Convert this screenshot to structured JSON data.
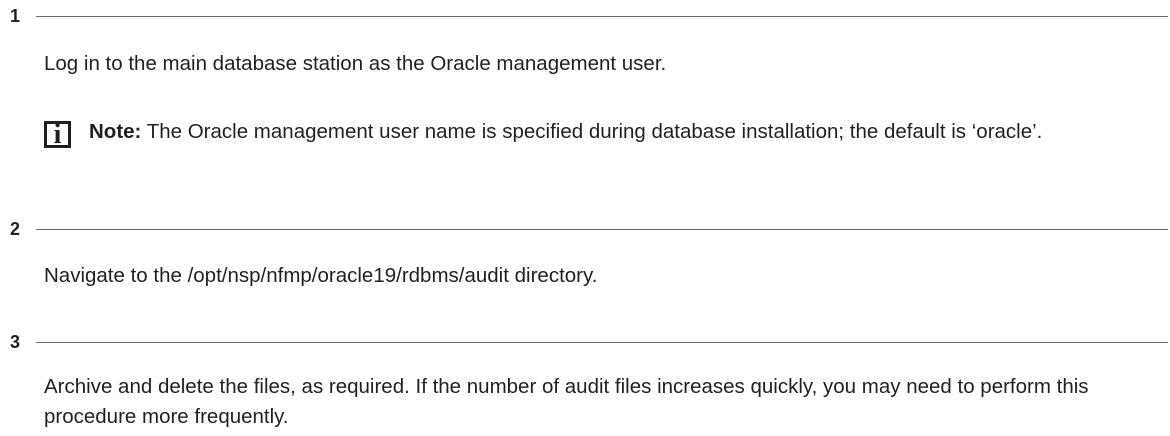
{
  "steps": [
    {
      "number": "1",
      "text": "Log in to the main database station as the Oracle management user.",
      "note": {
        "icon": "info-icon",
        "icon_glyph": "i",
        "label": "Note:",
        "text": " The Oracle management user name is specified during database installation; the default is ‘oracle’."
      }
    },
    {
      "number": "2",
      "text": "Navigate to the /opt/nsp/nfmp/oracle19/rdbms/audit directory."
    },
    {
      "number": "3",
      "text": "Archive and delete the files, as required. If the number of audit files increases quickly, you may need to perform this procedure more frequently."
    }
  ]
}
